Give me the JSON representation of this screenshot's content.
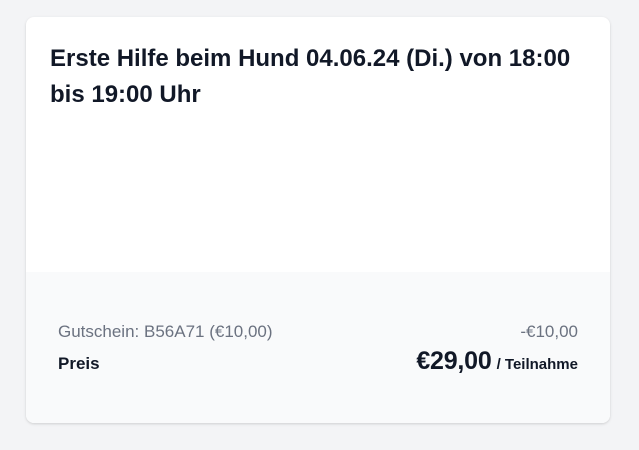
{
  "course": {
    "title": "Erste Hilfe beim Hund 04.06.24 (Di.) von 18:00 bis 19:00 Uhr"
  },
  "summary": {
    "voucher_label": "Gutschein: B56A71 (€10,00)",
    "voucher_discount": "-€10,00",
    "price_label": "Preis",
    "price_value": "€29,00",
    "price_unit": "/ Teilnahme"
  }
}
